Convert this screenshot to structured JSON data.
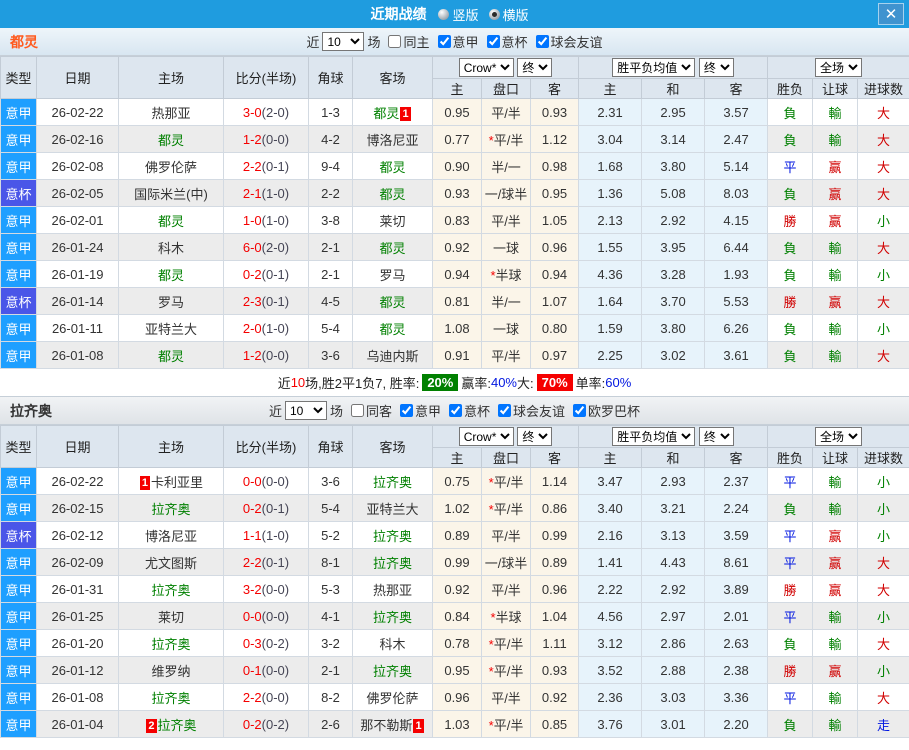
{
  "titlebar": {
    "title": "近期战绩",
    "vertical_label": "竖版",
    "horizontal_label": "横版",
    "close": "✕"
  },
  "controls": {
    "crow": "Crow*",
    "final": "终",
    "avg": "胜平负均值",
    "fulltime": "全场"
  },
  "columns": {
    "type": "类型",
    "date": "日期",
    "home": "主场",
    "score": "比分(半场)",
    "corner": "角球",
    "away": "客场",
    "odds_home": "主",
    "handicap": "盘口",
    "odds_away": "客",
    "avg_home": "主",
    "avg_draw": "和",
    "avg_away": "客",
    "result": "胜负",
    "handicap_result": "让球",
    "goals": "进球数"
  },
  "colors": {
    "league_blue": "#1e9fff",
    "cup_blue": "#4a56e8",
    "subject_green": "#008000",
    "win_red": "#d10000",
    "draw_blue": "#0016e0",
    "badge_red": "#f50000",
    "titlebar_blue": "#1f9cdf",
    "torino_orange": "#ff5a1e"
  },
  "sections": [
    {
      "team": "都灵",
      "filter": {
        "near": "近",
        "count": "10",
        "games": "场",
        "checkboxes": [
          {
            "label": "同主",
            "checked": false
          },
          {
            "label": "意甲",
            "checked": true
          },
          {
            "label": "意杯",
            "checked": true
          },
          {
            "label": "球会友谊",
            "checked": true
          }
        ]
      },
      "rows": [
        {
          "type": "意甲",
          "cup": false,
          "date": "26-02-22",
          "home": {
            "name": "热那亚"
          },
          "away": {
            "name": "都灵",
            "subject": true,
            "badge": "1",
            "badge_pos": "after"
          },
          "ft": "3-0",
          "ht": "(2-0)",
          "corner": "1-3",
          "o1": "0.95",
          "star": false,
          "hcap": "平/半",
          "o2": "0.93",
          "a1": "2.31",
          "a2": "2.95",
          "a3": "3.57",
          "r1": "負",
          "r2": "輸",
          "r3": "大"
        },
        {
          "type": "意甲",
          "cup": false,
          "date": "26-02-16",
          "home": {
            "name": "都灵",
            "subject": true
          },
          "away": {
            "name": "博洛尼亚"
          },
          "ft": "1-2",
          "ht": "(0-0)",
          "corner": "4-2",
          "o1": "0.77",
          "star": true,
          "hcap": "平/半",
          "o2": "1.12",
          "a1": "3.04",
          "a2": "3.14",
          "a3": "2.47",
          "r1": "負",
          "r2": "輸",
          "r3": "大"
        },
        {
          "type": "意甲",
          "cup": false,
          "date": "26-02-08",
          "home": {
            "name": "佛罗伦萨"
          },
          "away": {
            "name": "都灵",
            "subject": true
          },
          "ft": "2-2",
          "ht": "(0-1)",
          "corner": "9-4",
          "o1": "0.90",
          "star": false,
          "hcap": "半/一",
          "o2": "0.98",
          "a1": "1.68",
          "a2": "3.80",
          "a3": "5.14",
          "r1": "平",
          "r2": "赢",
          "r3": "大"
        },
        {
          "type": "意杯",
          "cup": true,
          "date": "26-02-05",
          "home": {
            "name": "国际米兰(中)"
          },
          "away": {
            "name": "都灵",
            "subject": true
          },
          "ft": "2-1",
          "ht": "(1-0)",
          "corner": "2-2",
          "o1": "0.93",
          "star": false,
          "hcap": "一/球半",
          "o2": "0.95",
          "a1": "1.36",
          "a2": "5.08",
          "a3": "8.03",
          "r1": "負",
          "r2": "赢",
          "r3": "大"
        },
        {
          "type": "意甲",
          "cup": false,
          "date": "26-02-01",
          "home": {
            "name": "都灵",
            "subject": true
          },
          "away": {
            "name": "莱切"
          },
          "ft": "1-0",
          "ht": "(1-0)",
          "corner": "3-8",
          "o1": "0.83",
          "star": false,
          "hcap": "平/半",
          "o2": "1.05",
          "a1": "2.13",
          "a2": "2.92",
          "a3": "4.15",
          "r1": "勝",
          "r2": "赢",
          "r3": "小"
        },
        {
          "type": "意甲",
          "cup": false,
          "date": "26-01-24",
          "home": {
            "name": "科木"
          },
          "away": {
            "name": "都灵",
            "subject": true
          },
          "ft": "6-0",
          "ht": "(2-0)",
          "corner": "2-1",
          "o1": "0.92",
          "star": false,
          "hcap": "一球",
          "o2": "0.96",
          "a1": "1.55",
          "a2": "3.95",
          "a3": "6.44",
          "r1": "負",
          "r2": "輸",
          "r3": "大"
        },
        {
          "type": "意甲",
          "cup": false,
          "date": "26-01-19",
          "home": {
            "name": "都灵",
            "subject": true
          },
          "away": {
            "name": "罗马"
          },
          "ft": "0-2",
          "ht": "(0-1)",
          "corner": "2-1",
          "o1": "0.94",
          "star": true,
          "hcap": "半球",
          "o2": "0.94",
          "a1": "4.36",
          "a2": "3.28",
          "a3": "1.93",
          "r1": "負",
          "r2": "輸",
          "r3": "小"
        },
        {
          "type": "意杯",
          "cup": true,
          "date": "26-01-14",
          "home": {
            "name": "罗马"
          },
          "away": {
            "name": "都灵",
            "subject": true
          },
          "ft": "2-3",
          "ht": "(0-1)",
          "corner": "4-5",
          "o1": "0.81",
          "star": false,
          "hcap": "半/一",
          "o2": "1.07",
          "a1": "1.64",
          "a2": "3.70",
          "a3": "5.53",
          "r1": "勝",
          "r2": "赢",
          "r3": "大"
        },
        {
          "type": "意甲",
          "cup": false,
          "date": "26-01-11",
          "home": {
            "name": "亚特兰大"
          },
          "away": {
            "name": "都灵",
            "subject": true
          },
          "ft": "2-0",
          "ht": "(1-0)",
          "corner": "5-4",
          "o1": "1.08",
          "star": false,
          "hcap": "一球",
          "o2": "0.80",
          "a1": "1.59",
          "a2": "3.80",
          "a3": "6.26",
          "r1": "負",
          "r2": "輸",
          "r3": "小"
        },
        {
          "type": "意甲",
          "cup": false,
          "date": "26-01-08",
          "home": {
            "name": "都灵",
            "subject": true
          },
          "away": {
            "name": "乌迪内斯"
          },
          "ft": "1-2",
          "ht": "(0-0)",
          "corner": "3-6",
          "o1": "0.91",
          "star": false,
          "hcap": "平/半",
          "o2": "0.97",
          "a1": "2.25",
          "a2": "3.02",
          "a3": "3.61",
          "r1": "負",
          "r2": "輸",
          "r3": "大"
        }
      ],
      "summary": [
        {
          "t": "近",
          "s": "plain"
        },
        {
          "t": "10",
          "s": "red"
        },
        {
          "t": "场,胜2平1负7, 胜率:",
          "s": "plain"
        },
        {
          "t": "20%",
          "s": "badge-green"
        },
        {
          "t": " 赢率:",
          "s": "plain"
        },
        {
          "t": "40%",
          "s": "blue"
        },
        {
          "t": " 大:",
          "s": "plain"
        },
        {
          "t": "70%",
          "s": "badge-red"
        },
        {
          "t": " 单率:",
          "s": "plain"
        },
        {
          "t": "60%",
          "s": "blue"
        }
      ]
    },
    {
      "team": "拉齐奥",
      "filter": {
        "near": "近",
        "count": "10",
        "games": "场",
        "checkboxes": [
          {
            "label": "同客",
            "checked": false
          },
          {
            "label": "意甲",
            "checked": true
          },
          {
            "label": "意杯",
            "checked": true
          },
          {
            "label": "球会友谊",
            "checked": true
          },
          {
            "label": "欧罗巴杯",
            "checked": true
          }
        ]
      },
      "rows": [
        {
          "type": "意甲",
          "cup": false,
          "date": "26-02-22",
          "home": {
            "name": "卡利亚里",
            "badge": "1",
            "badge_pos": "before"
          },
          "away": {
            "name": "拉齐奥",
            "subject": true
          },
          "ft": "0-0",
          "ht": "(0-0)",
          "corner": "3-6",
          "o1": "0.75",
          "star": true,
          "hcap": "平/半",
          "o2": "1.14",
          "a1": "3.47",
          "a2": "2.93",
          "a3": "2.37",
          "r1": "平",
          "r2": "輸",
          "r3": "小"
        },
        {
          "type": "意甲",
          "cup": false,
          "date": "26-02-15",
          "home": {
            "name": "拉齐奥",
            "subject": true
          },
          "away": {
            "name": "亚特兰大"
          },
          "ft": "0-2",
          "ht": "(0-1)",
          "corner": "5-4",
          "o1": "1.02",
          "star": true,
          "hcap": "平/半",
          "o2": "0.86",
          "a1": "3.40",
          "a2": "3.21",
          "a3": "2.24",
          "r1": "負",
          "r2": "輸",
          "r3": "小"
        },
        {
          "type": "意杯",
          "cup": true,
          "date": "26-02-12",
          "home": {
            "name": "博洛尼亚"
          },
          "away": {
            "name": "拉齐奥",
            "subject": true
          },
          "ft": "1-1",
          "ht": "(1-0)",
          "corner": "5-2",
          "o1": "0.89",
          "star": false,
          "hcap": "平/半",
          "o2": "0.99",
          "a1": "2.16",
          "a2": "3.13",
          "a3": "3.59",
          "r1": "平",
          "r2": "赢",
          "r3": "小"
        },
        {
          "type": "意甲",
          "cup": false,
          "date": "26-02-09",
          "home": {
            "name": "尤文图斯"
          },
          "away": {
            "name": "拉齐奥",
            "subject": true
          },
          "ft": "2-2",
          "ht": "(0-1)",
          "corner": "8-1",
          "o1": "0.99",
          "star": false,
          "hcap": "一/球半",
          "o2": "0.89",
          "a1": "1.41",
          "a2": "4.43",
          "a3": "8.61",
          "r1": "平",
          "r2": "赢",
          "r3": "大"
        },
        {
          "type": "意甲",
          "cup": false,
          "date": "26-01-31",
          "home": {
            "name": "拉齐奥",
            "subject": true
          },
          "away": {
            "name": "热那亚"
          },
          "ft": "3-2",
          "ht": "(0-0)",
          "corner": "5-3",
          "o1": "0.92",
          "star": false,
          "hcap": "平/半",
          "o2": "0.96",
          "a1": "2.22",
          "a2": "2.92",
          "a3": "3.89",
          "r1": "勝",
          "r2": "赢",
          "r3": "大"
        },
        {
          "type": "意甲",
          "cup": false,
          "date": "26-01-25",
          "home": {
            "name": "莱切"
          },
          "away": {
            "name": "拉齐奥",
            "subject": true
          },
          "ft": "0-0",
          "ht": "(0-0)",
          "corner": "4-1",
          "o1": "0.84",
          "star": true,
          "hcap": "半球",
          "o2": "1.04",
          "a1": "4.56",
          "a2": "2.97",
          "a3": "2.01",
          "r1": "平",
          "r2": "輸",
          "r3": "小"
        },
        {
          "type": "意甲",
          "cup": false,
          "date": "26-01-20",
          "home": {
            "name": "拉齐奥",
            "subject": true
          },
          "away": {
            "name": "科木"
          },
          "ft": "0-3",
          "ht": "(0-2)",
          "corner": "3-2",
          "o1": "0.78",
          "star": true,
          "hcap": "平/半",
          "o2": "1.11",
          "a1": "3.12",
          "a2": "2.86",
          "a3": "2.63",
          "r1": "負",
          "r2": "輸",
          "r3": "大"
        },
        {
          "type": "意甲",
          "cup": false,
          "date": "26-01-12",
          "home": {
            "name": "维罗纳"
          },
          "away": {
            "name": "拉齐奥",
            "subject": true
          },
          "ft": "0-1",
          "ht": "(0-0)",
          "corner": "2-1",
          "o1": "0.95",
          "star": true,
          "hcap": "平/半",
          "o2": "0.93",
          "a1": "3.52",
          "a2": "2.88",
          "a3": "2.38",
          "r1": "勝",
          "r2": "赢",
          "r3": "小"
        },
        {
          "type": "意甲",
          "cup": false,
          "date": "26-01-08",
          "home": {
            "name": "拉齐奥",
            "subject": true
          },
          "away": {
            "name": "佛罗伦萨"
          },
          "ft": "2-2",
          "ht": "(0-0)",
          "corner": "8-2",
          "o1": "0.96",
          "star": false,
          "hcap": "平/半",
          "o2": "0.92",
          "a1": "2.36",
          "a2": "3.03",
          "a3": "3.36",
          "r1": "平",
          "r2": "輸",
          "r3": "大"
        },
        {
          "type": "意甲",
          "cup": false,
          "date": "26-01-04",
          "home": {
            "name": "拉齐奥",
            "subject": true,
            "badge": "2",
            "badge_pos": "before"
          },
          "away": {
            "name": "那不勒斯",
            "badge": "1",
            "badge_pos": "after"
          },
          "ft": "0-2",
          "ht": "(0-2)",
          "corner": "2-6",
          "o1": "1.03",
          "star": true,
          "hcap": "平/半",
          "o2": "0.85",
          "a1": "3.76",
          "a2": "3.01",
          "a3": "2.20",
          "r1": "負",
          "r2": "輸",
          "r3": "走"
        }
      ]
    }
  ]
}
